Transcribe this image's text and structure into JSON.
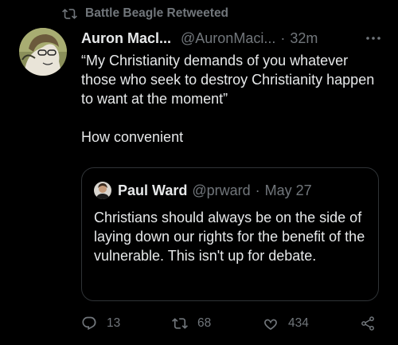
{
  "retweet": {
    "icon": "retweet-icon",
    "label": "Battle Beagle Retweeted"
  },
  "tweet": {
    "author_name": "Auron Macl...",
    "author_handle": "@AuronMaci...",
    "separator": "·",
    "time": "32m",
    "text": "“My Christianity demands of you whatever those who seek to destroy Christianity happen to want at the moment”\n\nHow convenient"
  },
  "quote": {
    "author_name": "Paul Ward",
    "author_handle": "@prward",
    "separator": "·",
    "date": "May 27",
    "text": "Christians should always be on the side of laying down our rights for the benefit of the vulnerable. This isn't up for debate."
  },
  "actions": {
    "reply_count": "13",
    "retweet_count": "68",
    "like_count": "434"
  },
  "colors": {
    "background": "#000000",
    "text": "#e7e9ea",
    "muted": "#71767b",
    "border": "#2f3336"
  }
}
